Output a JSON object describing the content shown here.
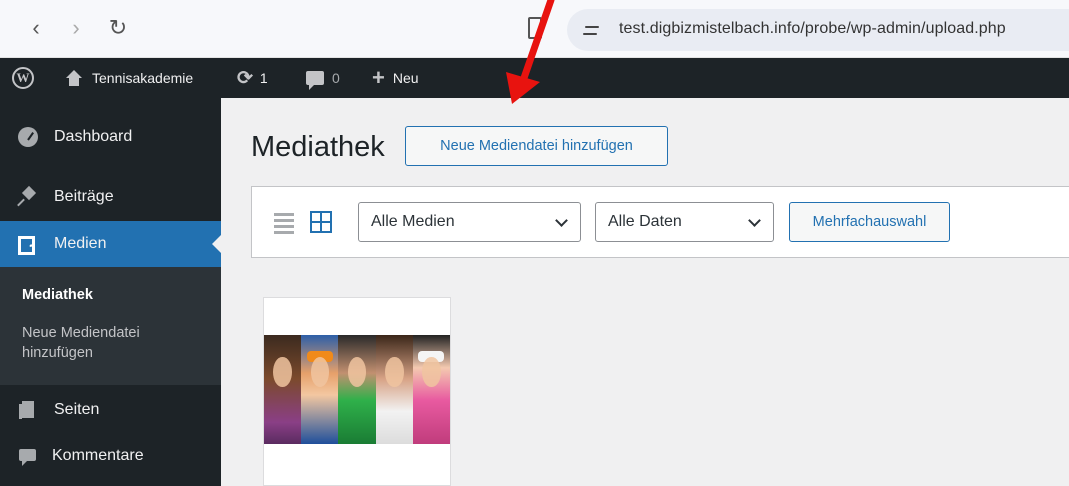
{
  "browser": {
    "back_glyph": "‹",
    "forward_glyph": "›",
    "reload_glyph": "↻",
    "url": "test.digbizmistelbach.info/probe/wp-admin/upload.php"
  },
  "admin_bar": {
    "logo": "W",
    "site_name": "Tennisakademie",
    "updates_count": "1",
    "comments_count": "0",
    "new_label": "Neu"
  },
  "sidebar": {
    "items": [
      {
        "label": "Dashboard",
        "icon": "dashboard-icon"
      },
      {
        "label": "Beiträge",
        "icon": "pin-icon"
      },
      {
        "label": "Medien",
        "icon": "media-icon",
        "active": true
      },
      {
        "label": "Seiten",
        "icon": "pages-icon"
      },
      {
        "label": "Kommentare",
        "icon": "comments-icon"
      }
    ],
    "submenu": {
      "mediathek": "Mediathek",
      "neue_mediendatei": "Neue Mediendatei hinzufügen"
    }
  },
  "main": {
    "title": "Mediathek",
    "add_new_button": "Neue Mediendatei hinzufügen",
    "filter_media": "Alle Medien",
    "filter_dates": "Alle Daten",
    "bulk_select": "Mehrfachauswahl"
  },
  "colors": {
    "accent": "#2271b1",
    "admin_bar": "#1d2327",
    "annotation_arrow": "#e8130f"
  }
}
